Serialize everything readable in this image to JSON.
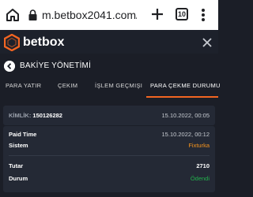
{
  "browser": {
    "url": "m.betbox2041.com/tr",
    "tab_count": "10"
  },
  "app": {
    "logo_text": "betbox"
  },
  "page": {
    "title": "BAKİYE YÖNETİMİ"
  },
  "tabs": [
    {
      "label": "PARA YATIR"
    },
    {
      "label": "ÇEKIM"
    },
    {
      "label": "İŞLEM GEÇMIŞI"
    },
    {
      "label": "PARA ÇEKME DURUMU"
    }
  ],
  "transaction": {
    "id_label": "KİMLİK:",
    "id_value": "150126282",
    "created_at": "15.10.2022, 00:05",
    "paid_time_label": "Paid Time",
    "paid_time_value": "15.10.2022, 00:12",
    "system_label": "Sistem",
    "system_value": "Fixturka",
    "amount_label": "Tutar",
    "amount_value": "2710",
    "status_label": "Durum",
    "status_value": "Ödendi"
  },
  "colors": {
    "accent": "#f26522",
    "system": "#f7941d",
    "paid": "#22b14c"
  }
}
